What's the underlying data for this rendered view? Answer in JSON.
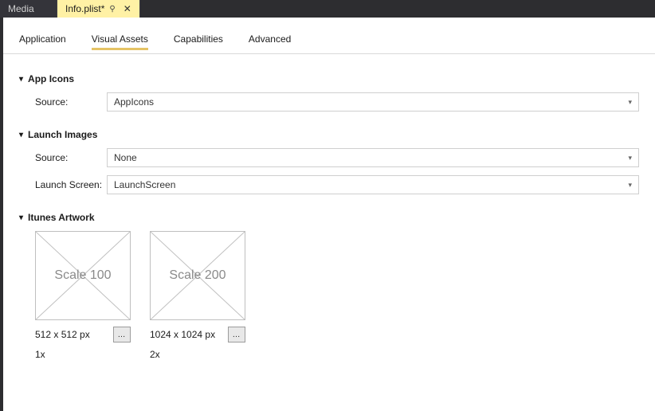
{
  "tabs": {
    "inactive": "Media",
    "active": "Info.plist*"
  },
  "subnav": {
    "items": [
      "Application",
      "Visual Assets",
      "Capabilities",
      "Advanced"
    ],
    "active_index": 1
  },
  "app_icons": {
    "title": "App Icons",
    "source_label": "Source:",
    "source_value": "AppIcons"
  },
  "launch_images": {
    "title": "Launch Images",
    "source_label": "Source:",
    "source_value": "None",
    "launch_screen_label": "Launch Screen:",
    "launch_screen_value": "LaunchScreen"
  },
  "itunes_artwork": {
    "title": "Itunes Artwork",
    "tiles": [
      {
        "placeholder": "Scale 100",
        "dim": "512 x 512 px",
        "scale": "1x"
      },
      {
        "placeholder": "Scale 200",
        "dim": "1024 x 1024 px",
        "scale": "2x"
      }
    ]
  }
}
